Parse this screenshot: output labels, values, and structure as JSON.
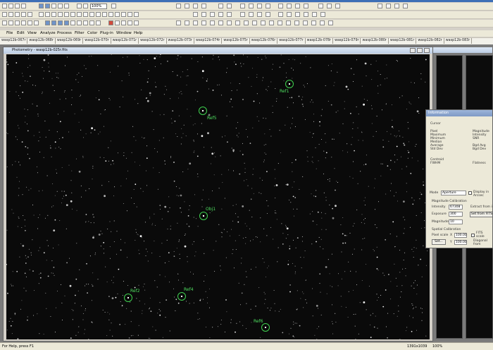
{
  "toolbar": {
    "zoom": "100%"
  },
  "menu": [
    "File",
    "Edit",
    "View",
    "Analyze",
    "Process",
    "Filter",
    "Color",
    "Plug-in",
    "Window",
    "Help"
  ],
  "tabs": [
    "wasp12b-067r",
    "wasp12b-068r",
    "wasp12b-069r",
    "wasp12b-070r",
    "wasp12b-071r",
    "wasp12b-072r",
    "wasp12b-073r",
    "wasp12b-074r",
    "wasp12b-075r",
    "wasp12b-076r",
    "wasp12b-077r",
    "wasp12b-078r",
    "wasp12b-079r",
    "wasp12b-080r",
    "wasp12b-081r",
    "wasp12b-082r",
    "wasp12b-083r"
  ],
  "window": {
    "title": "Photometry - wasp12b-025r.fits"
  },
  "apertures": [
    {
      "label": "Ref1"
    },
    {
      "label": "Ref5"
    },
    {
      "label": "Obj1"
    },
    {
      "label": "Ref2"
    },
    {
      "label": "Ref4"
    },
    {
      "label": "Ref6"
    }
  ],
  "info": {
    "title": "Information",
    "cursor_label": "Cursor",
    "pixel_labels": [
      "Pixel",
      "Maximum",
      "Minimum",
      "Median",
      "Average",
      "Std Dev"
    ],
    "mag_labels": [
      "Magnitude",
      "Intensity",
      "SNR",
      "",
      "Bgd Avg",
      "Bgd Dev"
    ],
    "centroid_labels": [
      "Centroid",
      "FWHM"
    ],
    "flatness_label": "Flatness",
    "mode_label": "Mode",
    "mode_value": "Aperture",
    "display_label": "Display in Arcsec",
    "mag_cal_label": "Magnitude Calibration",
    "intensity_label": "Intensity",
    "intensity_value": "67308",
    "exposure_label": "Exposure",
    "exposure_value": "300",
    "magnitude_label": "Magnitude",
    "magnitude_value": "10",
    "extract_label": "Extract from image",
    "setfits_label": "Set from FITS",
    "spatial_label": "Spatial Calibration",
    "pixelscale_label": "Pixel scale",
    "x_label": "X",
    "x_value": "100.00",
    "y_label": "Y",
    "y_value": "100.00",
    "fits_label": "FITS scale",
    "diag_label": "Diagonal from",
    "set_label": "Set..."
  },
  "status": {
    "help": "For Help, press F1",
    "coords": "1391x1039",
    "zoom": "100%"
  }
}
